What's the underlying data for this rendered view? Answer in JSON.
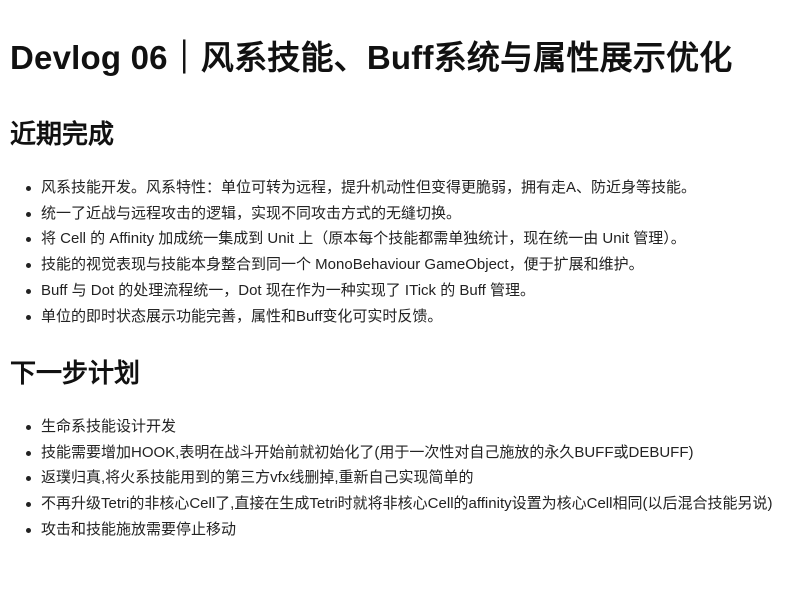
{
  "title": "Devlog 06｜风系技能、Buff系统与属性展示优化",
  "sections": [
    {
      "heading": "近期完成",
      "items": [
        "风系技能开发。风系特性：单位可转为远程，提升机动性但变得更脆弱，拥有走A、防近身等技能。",
        "统一了近战与远程攻击的逻辑，实现不同攻击方式的无缝切换。",
        "将 Cell 的 Affinity 加成统一集成到 Unit 上（原本每个技能都需单独统计，现在统一由 Unit 管理）。",
        "技能的视觉表现与技能本身整合到同一个 MonoBehaviour GameObject，便于扩展和维护。",
        "Buff 与 Dot 的处理流程统一，Dot 现在作为一种实现了 ITick 的 Buff 管理。",
        "单位的即时状态展示功能完善，属性和Buff变化可实时反馈。"
      ]
    },
    {
      "heading": "下一步计划",
      "items": [
        "生命系技能设计开发",
        "技能需要增加HOOK,表明在战斗开始前就初始化了(用于一次性对自己施放的永久BUFF或DEBUFF)",
        "返璞归真,将火系技能用到的第三方vfx线删掉,重新自己实现简单的",
        "不再升级Tetri的非核心Cell了,直接在生成Tetri时就将非核心Cell的affinity设置为核心Cell相同(以后混合技能另说)",
        "攻击和技能施放需要停止移动"
      ]
    }
  ]
}
